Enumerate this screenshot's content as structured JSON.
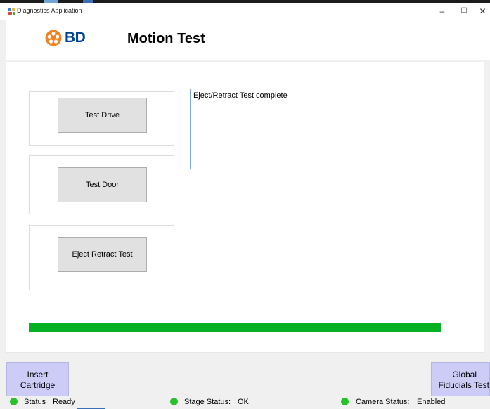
{
  "window": {
    "title": "Diagnostics Application",
    "controls": {
      "minimize": "–",
      "maximize": "☐",
      "close": "✕"
    }
  },
  "header": {
    "logo_text": "BD",
    "logo_color": "#f58220",
    "brand_color": "#004593",
    "page_title": "Motion Test"
  },
  "actions": {
    "test_drive": "Test Drive",
    "test_door": "Test Door",
    "eject_retract": "Eject Retract Test"
  },
  "output": {
    "text": "Eject/Retract Test complete"
  },
  "progress": {
    "value_percent": 100,
    "color": "#06b025"
  },
  "footer": {
    "insert_cartridge": [
      "Insert",
      "Cartridge"
    ],
    "global_fiducials": [
      "Global",
      "Fiducials Test"
    ]
  },
  "statusbar": {
    "status_label": "Status",
    "status_value": "Ready",
    "stage_label": "Stage Status:",
    "stage_value": "OK",
    "camera_label": "Camera Status:",
    "camera_value": "Enabled",
    "indicator_color": "#27c227"
  }
}
